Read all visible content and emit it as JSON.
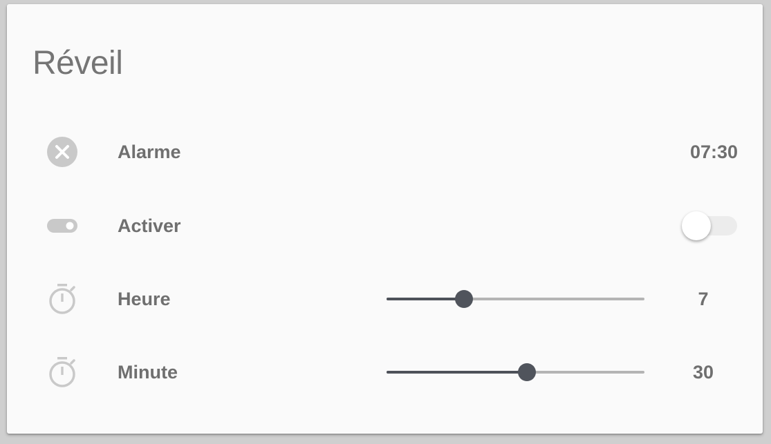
{
  "card": {
    "title": "Réveil"
  },
  "rows": {
    "alarm": {
      "icon": "close-circle-icon",
      "label": "Alarme",
      "value": "07:30"
    },
    "enable": {
      "icon": "toggle-switch-icon",
      "label": "Activer",
      "toggle_on": false
    },
    "hour": {
      "icon": "timer-icon",
      "label": "Heure",
      "value": "7",
      "slider_fraction": 0.3
    },
    "minute": {
      "icon": "timer-icon",
      "label": "Minute",
      "value": "30",
      "slider_fraction": 0.545
    }
  },
  "colors": {
    "icon": "#c9c9c9",
    "text": "#6f6f6f",
    "slider_active": "#4d5159",
    "slider_inactive": "#b4b4b4",
    "toggle_track_off": "#ececec"
  }
}
